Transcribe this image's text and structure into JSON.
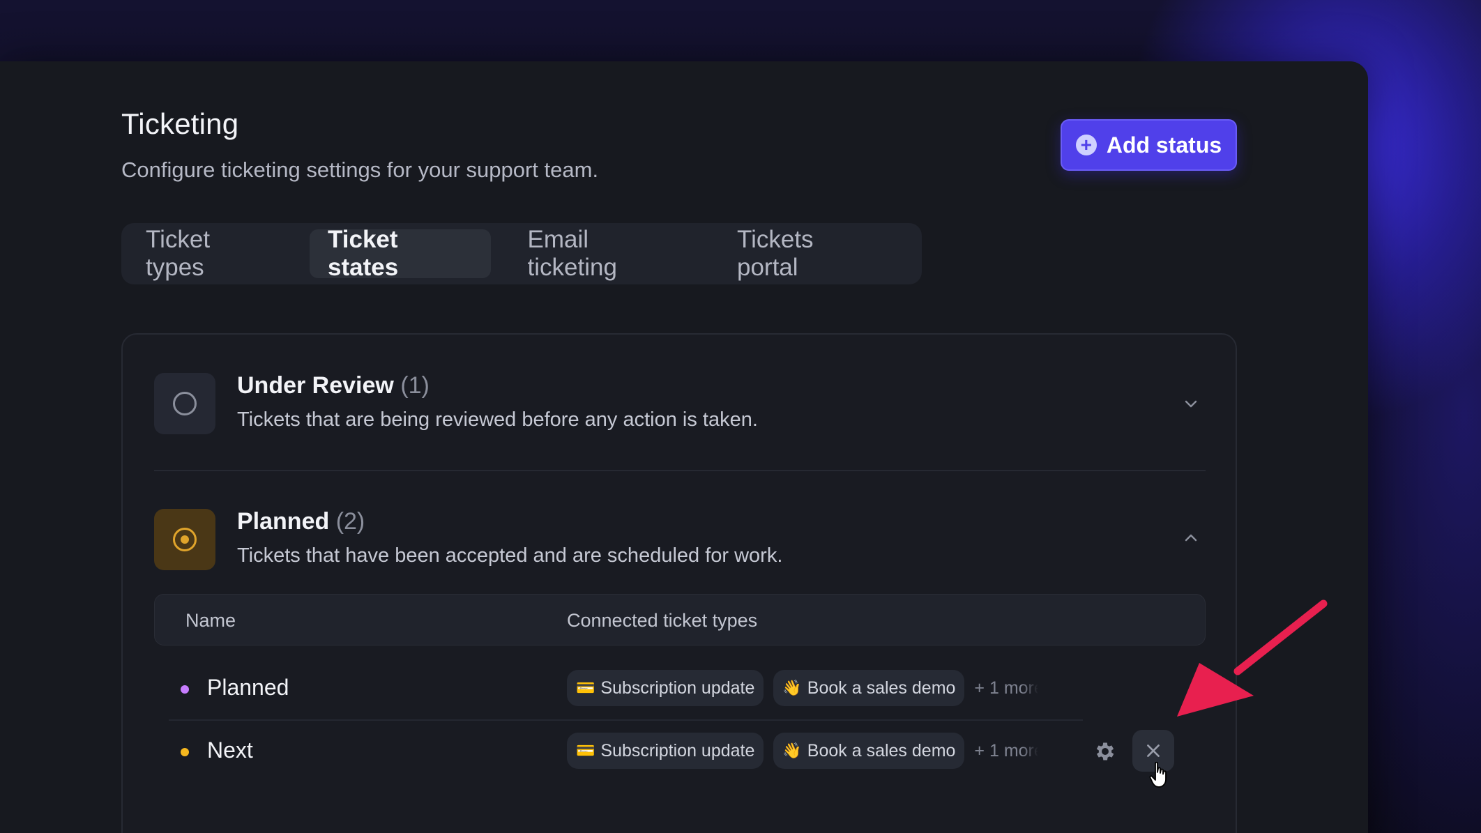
{
  "header": {
    "title": "Ticketing",
    "subtitle": "Configure ticketing settings for your support team.",
    "add_button_label": "Add status",
    "add_button_icon": "plus-circle-icon"
  },
  "tabs": [
    {
      "label": "Ticket types",
      "active": false
    },
    {
      "label": "Ticket states",
      "active": true
    },
    {
      "label": "Email ticketing",
      "active": false
    },
    {
      "label": "Tickets portal",
      "active": false
    }
  ],
  "states": [
    {
      "title": "Under Review",
      "count": "(1)",
      "description": "Tickets that are being reviewed before any action is taken.",
      "expanded": false,
      "icon_color": "#8b8f9c"
    },
    {
      "title": "Planned",
      "count": "(2)",
      "description": "Tickets that have been accepted and are scheduled for work.",
      "expanded": true,
      "icon_color": "#e0a42b"
    }
  ],
  "table": {
    "headers": [
      "Name",
      "Connected ticket types"
    ],
    "rows": [
      {
        "name": "Planned",
        "dot_color": "#c77dff",
        "chips": [
          {
            "emoji": "💳",
            "label": "Subscription update"
          },
          {
            "emoji": "👋",
            "label": "Book a sales demo"
          }
        ],
        "more": "+ 1 more"
      },
      {
        "name": "Next",
        "dot_color": "#f5b71f",
        "chips": [
          {
            "emoji": "💳",
            "label": "Subscription update"
          },
          {
            "emoji": "👋",
            "label": "Book a sales demo"
          }
        ],
        "more": "+ 1 more"
      }
    ]
  },
  "colors": {
    "accent": "#5040ea",
    "annotation_arrow": "#e8204f",
    "background": "#17191f"
  }
}
